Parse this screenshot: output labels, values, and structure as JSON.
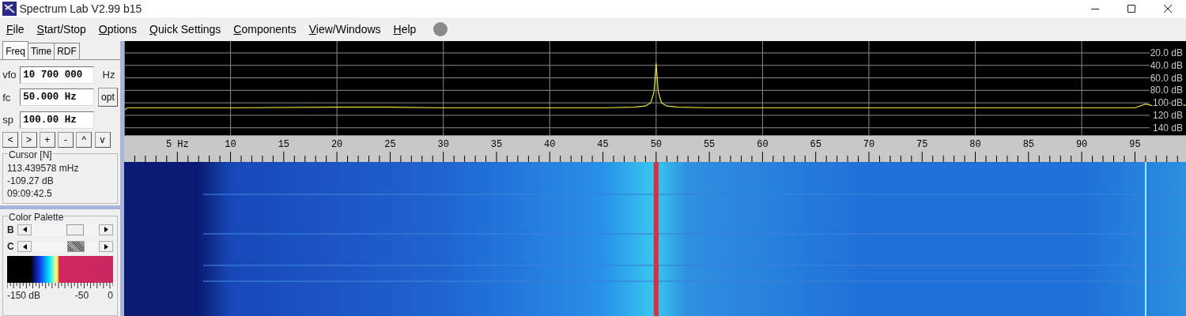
{
  "window": {
    "title": "Spectrum Lab V2.99 b15"
  },
  "menu": [
    "File",
    "Start/Stop",
    "Options",
    "Quick Settings",
    "Components",
    "View/Windows",
    "Help"
  ],
  "tabs": [
    {
      "label": "Freq",
      "selected": true
    },
    {
      "label": "Time",
      "selected": false
    },
    {
      "label": "RDF",
      "selected": false
    }
  ],
  "fields": [
    {
      "label": "vfo",
      "value": "10 700 000",
      "unit": "Hz"
    },
    {
      "label": "fc",
      "value": "50.000 Hz",
      "button": "opt"
    },
    {
      "label": "sp",
      "value": "100.00 Hz"
    }
  ],
  "step_buttons": [
    "<",
    ">",
    "+",
    "-",
    "^",
    "v"
  ],
  "cursor": {
    "title": "Cursor [N]",
    "lines": [
      "113.439578 mHz",
      "-109.27 dB",
      "09:09:42.5"
    ]
  },
  "color_palette": {
    "title": "Color Palette",
    "sliders": [
      {
        "label": "B",
        "level": 0.7,
        "focused": false
      },
      {
        "label": "C",
        "level": 0.72,
        "focused": true
      }
    ],
    "scale_labels": [
      "-150 dB",
      "-50",
      "0"
    ]
  },
  "spectrum": {
    "chart_data": {
      "type": "line",
      "grid": true,
      "xlim": [
        0,
        99.8
      ],
      "ylim": [
        -153,
        -1
      ],
      "xticks": [
        {
          "value": 5,
          "label": "5 Hz"
        },
        10,
        15,
        20,
        25,
        30,
        35,
        40,
        45,
        50,
        55,
        60,
        65,
        70,
        75,
        80,
        85,
        90,
        95
      ],
      "yticks": [
        {
          "value": -20,
          "label": "20.0 dB"
        },
        {
          "value": -40,
          "label": "40.0 dB"
        },
        {
          "value": -60,
          "label": "60.0 dB"
        },
        {
          "value": -80,
          "label": "80.0 dB"
        },
        {
          "value": -100,
          "label": "100 dB"
        },
        {
          "value": -120,
          "label": "120 dB"
        },
        {
          "value": -140,
          "label": "140 dB"
        }
      ],
      "series": [
        {
          "color": "#e8e040",
          "x": [
            0,
            0.3,
            5,
            10,
            20,
            25,
            30,
            40,
            45,
            48,
            49,
            49.5,
            49.8,
            50,
            50.2,
            50.5,
            51,
            52,
            55,
            60,
            70,
            80,
            90,
            95,
            96,
            97,
            98,
            99.8
          ],
          "values": [
            -112,
            -108,
            -108,
            -108,
            -107,
            -107,
            -108,
            -108,
            -108,
            -107,
            -105,
            -100,
            -82,
            -37,
            -82,
            -100,
            -105,
            -107,
            -108,
            -108,
            -108,
            -108,
            -108,
            -108,
            -102,
            -106,
            -100,
            -104
          ]
        }
      ]
    }
  }
}
